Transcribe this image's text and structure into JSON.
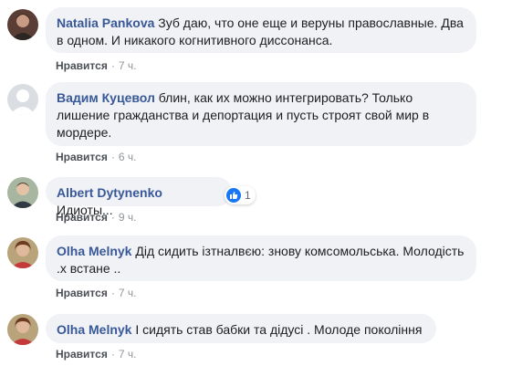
{
  "comments": [
    {
      "author": "Natalia Pankova",
      "text": "Зуб даю, что оне еще и веруны православные. Два в одном. И никакого когнитивного диссонанса.",
      "like_label": "Нравится",
      "separator": "·",
      "time": "7 ч.",
      "avatar_icon": "user-photo-icon"
    },
    {
      "author": "Вадим Куцевол",
      "text": "блин, как их можно интегрировать? Только лишение гражданства и депортация и пусть строят свой мир в мордере.",
      "like_label": "Нравится",
      "separator": "·",
      "time": "6 ч.",
      "avatar_icon": "default-avatar-icon"
    },
    {
      "author": "Albert Dytynenko",
      "text": "Идиоты...",
      "like_label": "Нравится",
      "separator": "·",
      "time": "9 ч.",
      "avatar_icon": "user-photo-icon",
      "reaction_count": "1",
      "reaction_icon": "like-thumb-icon"
    },
    {
      "author": "Olha Melnyk",
      "text": "Дід сидить ізтналвєю: знову комсомольська. Молодість .х встане ..",
      "like_label": "Нравится",
      "separator": "·",
      "time": "7 ч.",
      "avatar_icon": "user-photo-icon"
    },
    {
      "author": "Olha Melnyk",
      "text": "І сидять став бабки та дідусі . Молоде покоління",
      "like_label": "Нравится",
      "separator": "·",
      "time": "7 ч.",
      "avatar_icon": "user-photo-icon"
    }
  ],
  "colors": {
    "author": "#385898",
    "bubble": "#f0f2f5",
    "meta": "#90949c",
    "like_blue": "#1877f2"
  }
}
